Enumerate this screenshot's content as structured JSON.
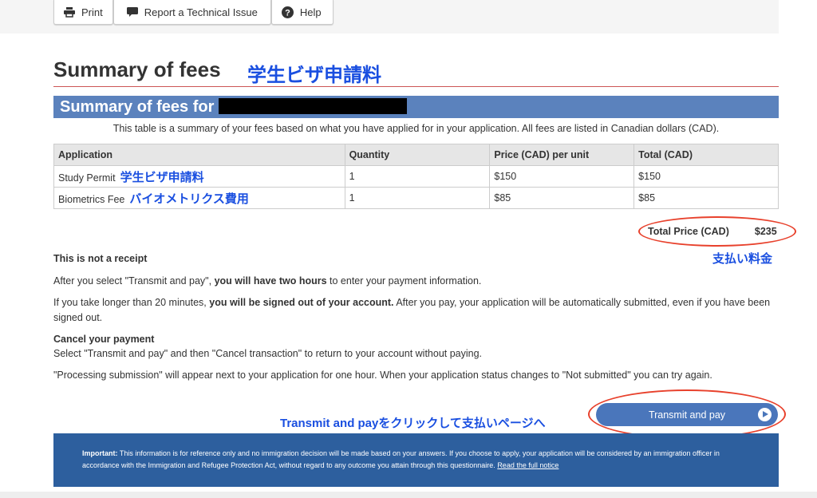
{
  "toolbar": {
    "print": "Print",
    "report": "Report a Technical Issue",
    "help": "Help"
  },
  "page": {
    "title": "Summary of fees",
    "title_annotation": "学生ビザ申請料"
  },
  "section": {
    "heading": "Summary of fees for",
    "intro": "This table is a summary of your fees based on what you have applied for in your application. All fees are listed in Canadian dollars (CAD)."
  },
  "table": {
    "headers": [
      "Application",
      "Quantity",
      "Price (CAD) per unit",
      "Total (CAD)"
    ],
    "rows": [
      {
        "application": "Study Permit",
        "annotation": "学生ビザ申請料",
        "quantity": "1",
        "price": "$150",
        "total": "$150"
      },
      {
        "application": "Biometrics Fee",
        "annotation": "バイオメトリクス費用",
        "quantity": "1",
        "price": "$85",
        "total": "$85"
      }
    ]
  },
  "total": {
    "label": "Total Price (CAD)",
    "value": "$235",
    "annotation": "支払い料金"
  },
  "notice": {
    "heading": "This is not a receipt",
    "p1_a": "After you select \"Transmit and pay\", ",
    "p1_b": "you will have two hours",
    "p1_c": " to enter your payment information.",
    "p2_a": "If you take longer than 20 minutes, ",
    "p2_b": "you will be signed out of your account.",
    "p2_c": " After you pay, your application will be automatically submitted, even if you have been signed out.",
    "cancel_heading": "Cancel your payment",
    "p3": "Select \"Transmit and pay\" and then \"Cancel transaction\" to return to your account without paying.",
    "p4": "\"Processing submission\" will appear next to your application for one hour. When your application status changes to \"Not submitted\" you can try again."
  },
  "action": {
    "annotation": "Transmit and payをクリックして支払いページへ",
    "button": "Transmit and pay"
  },
  "footer": {
    "important": "Important:",
    "text": " This information is for reference only and no immigration decision will be made based on your answers. If you choose to apply, your application will be considered by an immigration officer in accordance with the Immigration and Refugee Protection Act, without regard to any outcome you attain through this questionnaire. ",
    "link": "Read the full notice"
  },
  "colors": {
    "header_blue": "#5b82bd",
    "footer_blue": "#2d5f9e",
    "annotation_blue": "#1a4fe0",
    "annotation_red": "#e8412c"
  }
}
